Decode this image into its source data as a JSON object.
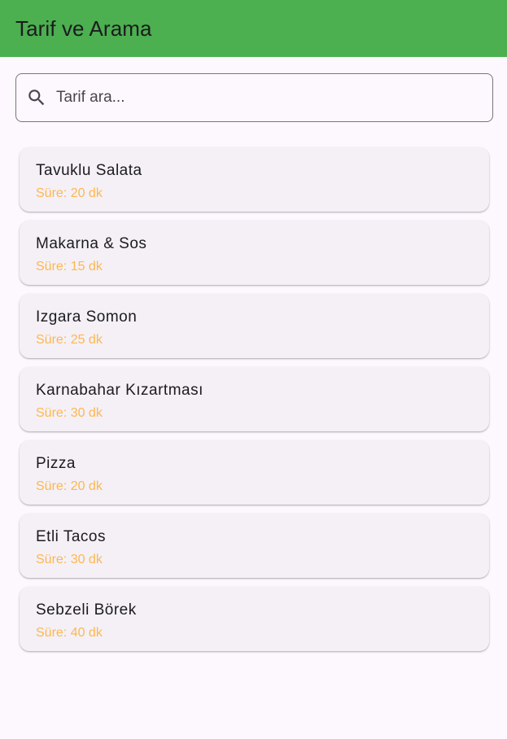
{
  "appbar": {
    "title": "Tarif ve Arama",
    "color": "#4CAF50"
  },
  "search": {
    "icon": "search-icon",
    "placeholder": "Tarif ara...",
    "value": ""
  },
  "recipes": [
    {
      "name": "Tavuklu Salata",
      "duration": "Süre: 20 dk"
    },
    {
      "name": "Makarna & Sos",
      "duration": "Süre: 15 dk"
    },
    {
      "name": "Izgara Somon",
      "duration": "Süre: 25 dk"
    },
    {
      "name": "Karnabahar Kızartması",
      "duration": "Süre: 30 dk"
    },
    {
      "name": "Pizza",
      "duration": "Süre: 20 dk"
    },
    {
      "name": "Etli Tacos",
      "duration": "Süre: 30 dk"
    },
    {
      "name": "Sebzeli Börek",
      "duration": "Süre: 40 dk"
    }
  ],
  "colors": {
    "background": "#FDF7FE",
    "card": "#F4F0F6",
    "duration_text": "#FFB74D",
    "title_text": "#1C1B1F"
  }
}
